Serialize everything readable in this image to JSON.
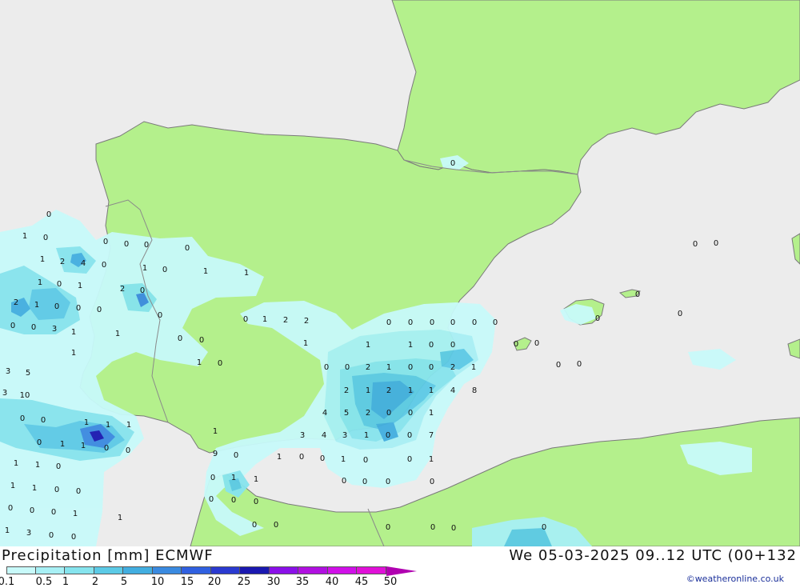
{
  "title": "Precipitation [mm] ECMWF",
  "timestamp": "We 05-03-2025 09..12 UTC (00+132",
  "credit": "©weatheronline.co.uk",
  "legend": {
    "labels": [
      "0.1",
      "0.5",
      "1",
      "2",
      "5",
      "10",
      "15",
      "20",
      "25",
      "30",
      "35",
      "40",
      "45",
      "50"
    ],
    "colors": [
      "#c8fafa",
      "#a8f0f5",
      "#86e4ee",
      "#5ccae6",
      "#42aee0",
      "#3a8ae0",
      "#3060e0",
      "#2a3ad0",
      "#1a18b0",
      "#8a10e8",
      "#b010e0",
      "#d010e8",
      "#e010d8",
      "#b000b0"
    ]
  },
  "map": {
    "colors": {
      "sea": "#ececec",
      "land": "#b4f08c",
      "border": "#8a8a8a",
      "coast": "#7a7a7a"
    },
    "values": [
      "0",
      "1",
      "0",
      "1",
      "2",
      "4",
      "0",
      "0",
      "0",
      "0",
      "0",
      "0",
      "1",
      "1",
      "0",
      "1",
      "2",
      "0",
      "1",
      "1",
      "2",
      "1",
      "0",
      "0",
      "0",
      "0",
      "3",
      "0",
      "0",
      "1",
      "1",
      "0",
      "0",
      "1",
      "1",
      "0",
      "0",
      "1",
      "2",
      "2",
      "1",
      "3",
      "5",
      "3",
      "10",
      "0",
      "0",
      "1",
      "1",
      "1",
      "0",
      "1",
      "1",
      "0",
      "0",
      "1",
      "1",
      "0",
      "1",
      "1",
      "0",
      "0",
      "0",
      "0",
      "0",
      "1",
      "1",
      "1",
      "3",
      "0",
      "0",
      "0",
      "0",
      "0",
      "0",
      "0",
      "0",
      "1",
      "1",
      "0",
      "0",
      "0",
      "0",
      "2",
      "1",
      "0",
      "0",
      "2",
      "1",
      "2",
      "1",
      "2",
      "1",
      "1",
      "4",
      "8",
      "4",
      "5",
      "2",
      "0",
      "0",
      "1",
      "3",
      "4",
      "3",
      "1",
      "0",
      "0",
      "7",
      "1",
      "9",
      "0",
      "1",
      "0",
      "0",
      "1",
      "0",
      "0",
      "1",
      "0",
      "1",
      "1",
      "0",
      "0",
      "0",
      "0",
      "0",
      "0",
      "0",
      "0",
      "0",
      "0",
      "0",
      "0",
      "0",
      "0",
      "0",
      "0",
      "0",
      "0",
      "0",
      "0",
      "0",
      "0",
      "0"
    ]
  }
}
